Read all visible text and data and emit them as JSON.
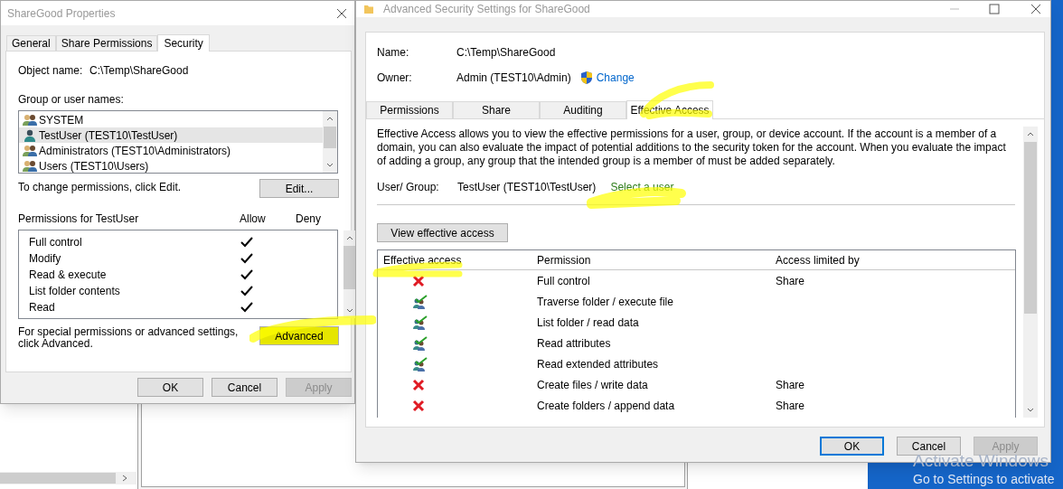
{
  "properties_window": {
    "title": "ShareGood Properties",
    "tabs": [
      {
        "label": "General",
        "selected": false
      },
      {
        "label": "Share Permissions",
        "selected": false
      },
      {
        "label": "Security",
        "selected": true
      }
    ],
    "object_name_label": "Object name:",
    "object_name": "C:\\Temp\\ShareGood",
    "group_label": "Group or user names:",
    "users": [
      {
        "name": "SYSTEM",
        "kind": "group",
        "selected": false
      },
      {
        "name": "TestUser (TEST10\\TestUser)",
        "kind": "user",
        "selected": true
      },
      {
        "name": "Administrators (TEST10\\Administrators)",
        "kind": "group",
        "selected": false
      },
      {
        "name": "Users (TEST10\\Users)",
        "kind": "group",
        "selected": false
      }
    ],
    "edit_hint": "To change permissions, click Edit.",
    "edit_button": "Edit...",
    "permissions_label": "Permissions for TestUser",
    "allow_label": "Allow",
    "deny_label": "Deny",
    "permissions": [
      {
        "name": "Full control",
        "allow": true,
        "deny": false
      },
      {
        "name": "Modify",
        "allow": true,
        "deny": false
      },
      {
        "name": "Read & execute",
        "allow": true,
        "deny": false
      },
      {
        "name": "List folder contents",
        "allow": true,
        "deny": false
      },
      {
        "name": "Read",
        "allow": true,
        "deny": false
      }
    ],
    "advanced_hint": "For special permissions or advanced settings, click Advanced.",
    "advanced_button": "Advanced",
    "buttons": [
      {
        "label": "OK",
        "disabled": false
      },
      {
        "label": "Cancel",
        "disabled": false
      },
      {
        "label": "Apply",
        "disabled": true
      }
    ]
  },
  "advanced_window": {
    "title": "Advanced Security Settings for ShareGood",
    "name_label": "Name:",
    "name": "C:\\Temp\\ShareGood",
    "owner_label": "Owner:",
    "owner": "Admin (TEST10\\Admin)",
    "change_link": "Change",
    "tabs": [
      {
        "label": "Permissions",
        "selected": false
      },
      {
        "label": "Share",
        "selected": false
      },
      {
        "label": "Auditing",
        "selected": false
      },
      {
        "label": "Effective Access",
        "selected": true
      }
    ],
    "description": "Effective Access allows you to view the effective permissions for a user, group, or device account. If the account is a member of a domain, you can also evaluate the impact of potential additions to the security token for the account. When you evaluate the impact of adding a group, any group that the intended group is a member of must be added separately.",
    "user_group_label": "User/ Group:",
    "user_group": "TestUser (TEST10\\TestUser)",
    "select_user_link": "Select a user",
    "view_button": "View effective access",
    "columns": [
      "Effective access",
      "Permission",
      "Access limited by"
    ],
    "rows": [
      {
        "allowed": false,
        "permission": "Full control",
        "limited_by": "Share"
      },
      {
        "allowed": true,
        "permission": "Traverse folder / execute file"
      },
      {
        "allowed": true,
        "permission": "List folder / read data"
      },
      {
        "allowed": true,
        "permission": "Read attributes"
      },
      {
        "allowed": true,
        "permission": "Read extended attributes"
      },
      {
        "allowed": false,
        "permission": "Create files / write data",
        "limited_by": "Share"
      },
      {
        "allowed": false,
        "permission": "Create folders / append data",
        "limited_by": "Share"
      }
    ],
    "buttons": [
      {
        "label": "OK",
        "disabled": false,
        "default": true
      },
      {
        "label": "Cancel",
        "disabled": false,
        "default": false
      },
      {
        "label": "Apply",
        "disabled": true,
        "default": false
      }
    ]
  },
  "watermark": {
    "title": "Activate Windows",
    "subtitle": "Go to Settings to activate"
  }
}
